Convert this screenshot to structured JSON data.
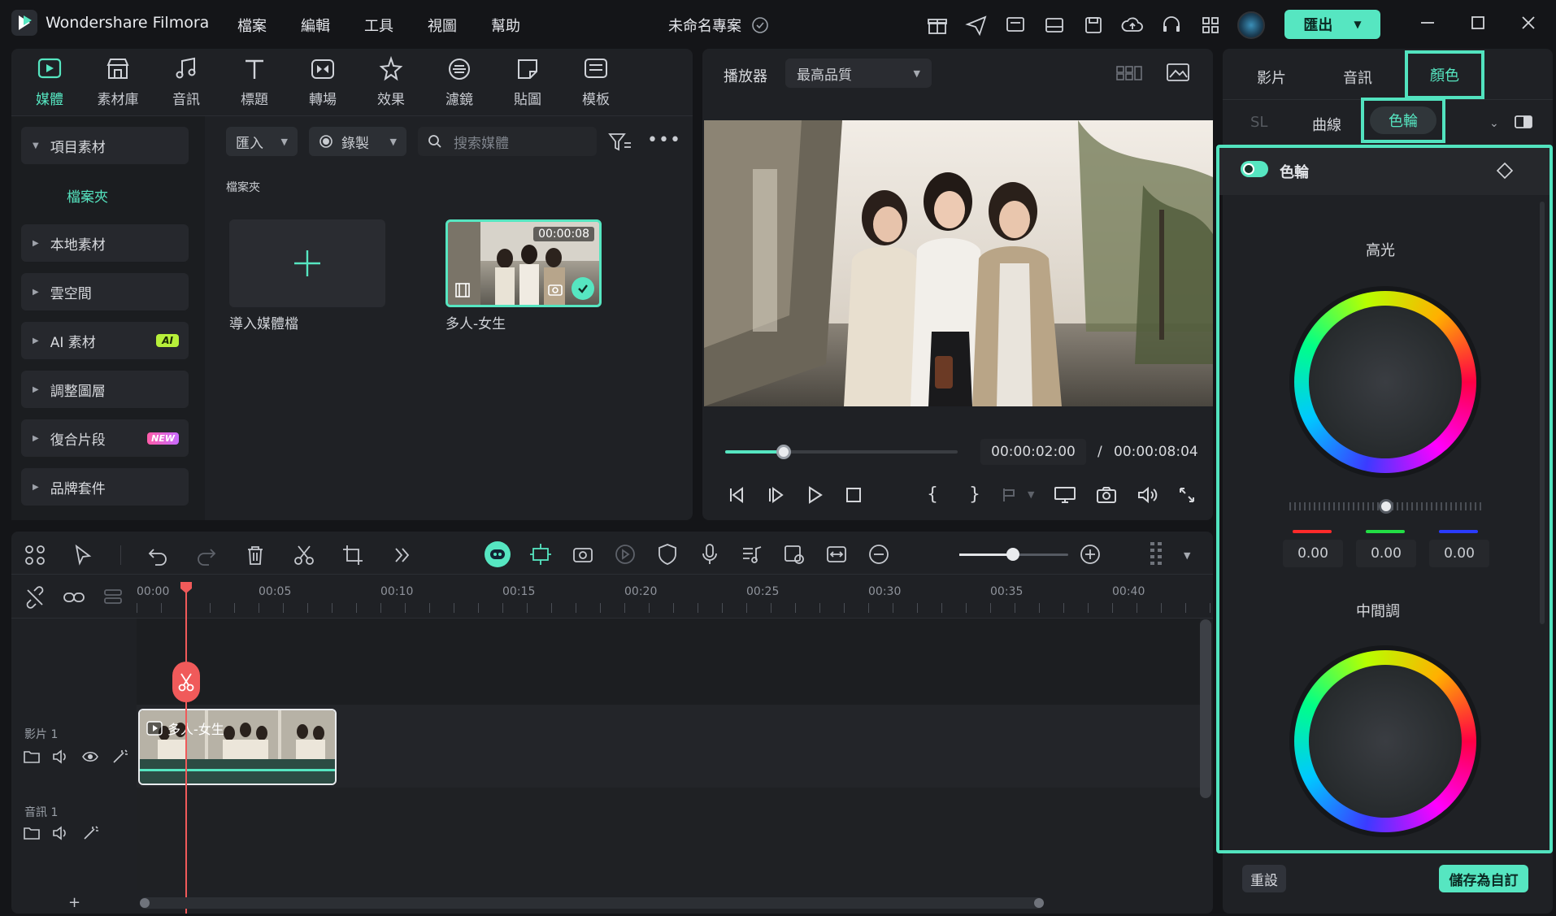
{
  "app": {
    "title": "Wondershare Filmora",
    "project_name": "未命名專案"
  },
  "menu": [
    "檔案",
    "編輯",
    "工具",
    "視圖",
    "幫助"
  ],
  "export_label": "匯出",
  "toolbar_tabs": [
    "媒體",
    "素材庫",
    "音訊",
    "標題",
    "轉場",
    "效果",
    "濾鏡",
    "貼圖",
    "模板"
  ],
  "sidebar": {
    "project_media": "項目素材",
    "folder": "檔案夾",
    "items": [
      {
        "label": "本地素材"
      },
      {
        "label": "雲空間"
      },
      {
        "label": "AI 素材",
        "badge": "AI"
      },
      {
        "label": "調整圖層"
      },
      {
        "label": "復合片段",
        "badge": "NEW"
      },
      {
        "label": "品牌套件"
      }
    ]
  },
  "media": {
    "import_label": "匯入",
    "record_label": "錄製",
    "search_placeholder": "搜索媒體",
    "folder_title": "檔案夾",
    "import_tile_label": "導入媒體檔",
    "clip_name": "多人-女生",
    "clip_duration": "00:00:08"
  },
  "player": {
    "label": "播放器",
    "quality": "最高品質",
    "current_time": "00:00:02:00",
    "separator": "/",
    "total_time": "00:00:08:04",
    "progress": 0.25
  },
  "timeline": {
    "ruler": [
      "00:00",
      "00:05",
      "00:10",
      "00:15",
      "00:20",
      "00:25",
      "00:30",
      "00:35",
      "00:40"
    ],
    "video_track": "影片 1",
    "audio_track": "音訊 1",
    "clip_label": "多人-女生",
    "add_label": "+"
  },
  "right_panel": {
    "tabs": [
      "影片",
      "音訊",
      "顏色"
    ],
    "subtabs": [
      "SL",
      "曲線",
      "色輪"
    ],
    "section_title": "色輪",
    "highlights_label": "高光",
    "midtones_label": "中間調",
    "rgb_values": [
      "0.00",
      "0.00",
      "0.00"
    ],
    "reset_label": "重設",
    "save_custom_label": "儲存為自訂"
  },
  "colors": {
    "accent": "#56e6c1",
    "playhead": "#f05a5a"
  }
}
